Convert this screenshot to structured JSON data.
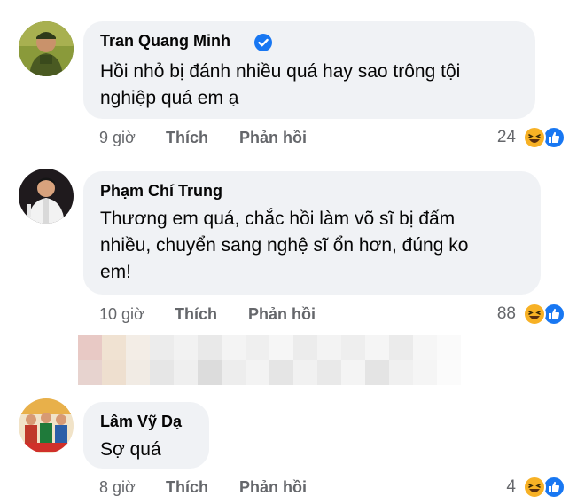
{
  "comments": [
    {
      "author": "Tran Quang Minh",
      "lines": [
        "Hồi nhỏ bị đánh nhiều quá hay sao trông tội",
        "nghiệp quá em ạ"
      ],
      "time": "9 giờ",
      "like_label": "Thích",
      "reply_label": "Phản hồi",
      "reactions": "24",
      "verified": true
    },
    {
      "author": "Phạm Chí Trung",
      "lines": [
        "Thương em quá, chắc hồi làm võ sĩ bị đấm",
        "nhiều, chuyển sang nghệ sĩ ổn hơn, đúng ko",
        "em!"
      ],
      "time": "10 giờ",
      "like_label": "Thích",
      "reply_label": "Phản hồi",
      "reactions": "88"
    },
    {
      "author": "Lâm Vỹ Dạ",
      "lines": [
        "Sợ quá"
      ],
      "time": "8 giờ",
      "like_label": "Thích",
      "reply_label": "Phản hồi",
      "reactions": "4"
    }
  ],
  "icons": {
    "verified": "verified-badge-icon",
    "haha": "haha-reaction-icon",
    "like": "like-reaction-icon"
  },
  "colors": {
    "bubble": "#f0f2f5",
    "meta_text": "#65676b",
    "accent": "#1877f2",
    "haha": "#f7b125"
  }
}
